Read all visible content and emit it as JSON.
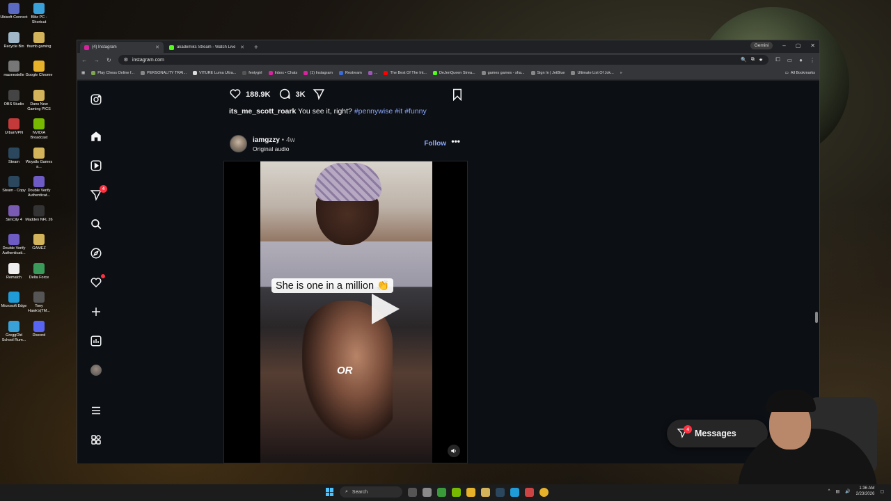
{
  "desktop": {
    "icons": [
      {
        "label": "Ubisoft Connect",
        "color": "#5b6bc4"
      },
      {
        "label": "Blitz PC - Shortcut",
        "color": "#3aa0d8"
      },
      {
        "label": "Recycle Bin",
        "color": "#9fb7c9"
      },
      {
        "label": "thumb gaming",
        "color": "#d4b45a"
      },
      {
        "label": "maxnestelle",
        "color": "#777777"
      },
      {
        "label": "Google Chrome",
        "color": "#e8b12a"
      },
      {
        "label": "OBS Studio",
        "color": "#444444"
      },
      {
        "label": "Dans New Gaming PICS",
        "color": "#d4b45a"
      },
      {
        "label": "UrbanVPN",
        "color": "#c43a3a"
      },
      {
        "label": "NVIDIA Broadcast",
        "color": "#76b900"
      },
      {
        "label": "Steam",
        "color": "#2a475e"
      },
      {
        "label": "Woyalls Games a...",
        "color": "#d4b45a"
      },
      {
        "label": "Steam - Copy",
        "color": "#2a475e"
      },
      {
        "label": "Double Verify Authenticat...",
        "color": "#6e5bc4"
      },
      {
        "label": "SimCity 4",
        "color": "#7a5bb4"
      },
      {
        "label": "Madden NFL 26",
        "color": "#333333"
      },
      {
        "label": "Double Verify Authenticati...",
        "color": "#6e5bc4"
      },
      {
        "label": "GAMEZ",
        "color": "#d4b45a"
      },
      {
        "label": "Rematch",
        "color": "#eeeeee"
      },
      {
        "label": "Delta Force",
        "color": "#3a9a5a"
      },
      {
        "label": "Microsoft Edge",
        "color": "#1f9bd8"
      },
      {
        "label": "Tony Hawk's(TM...",
        "color": "#555555"
      },
      {
        "label": "GreggOld School Rum...",
        "color": "#3aa0d8"
      },
      {
        "label": "Discord",
        "color": "#5865f2"
      }
    ]
  },
  "browser": {
    "tabs": [
      {
        "label": "(4) Instagram",
        "active": true,
        "color": "#d6249f"
      },
      {
        "label": "akademiks Stream - Watch Live",
        "active": false,
        "color": "#53fc18"
      }
    ],
    "new_tab": "+",
    "gemini": "Gemini",
    "window_controls": {
      "minimize": "–",
      "maximize": "▢",
      "close": "✕"
    },
    "url": "instagram.com",
    "bookmarks": [
      {
        "label": "Play Chess Online f...",
        "color": "#7fa650"
      },
      {
        "label": "PERSONALITY TRAI...",
        "color": "#888888"
      },
      {
        "label": "VITURE Luma Ultra...",
        "color": "#dddddd"
      },
      {
        "label": "fentygirl",
        "color": "#555555"
      },
      {
        "label": "Inbox • Chats",
        "color": "#d6249f"
      },
      {
        "label": "(1) Instagram",
        "color": "#d6249f"
      },
      {
        "label": "Restream",
        "color": "#3a6bd8"
      },
      {
        "label": "...",
        "color": "#9b59b6"
      },
      {
        "label": "The Best Of The Int...",
        "color": "#ff0000"
      },
      {
        "label": "DeJenQueen Strea...",
        "color": "#53fc18"
      },
      {
        "label": "games games - sha...",
        "color": "#888888"
      },
      {
        "label": "Sign In | JetBlue",
        "color": "#888888"
      },
      {
        "label": "Ultimate List Of Jok...",
        "color": "#888888"
      }
    ],
    "all_bookmarks": "All Bookmarks"
  },
  "instagram": {
    "sidebar": {
      "notifications_badge": "4"
    },
    "prev_post": {
      "likes": "188.9K",
      "comments": "3K",
      "caption_user": "its_me_scott_roark",
      "caption_text": "You see it, right?",
      "caption_tags": "#pennywise #it #funny"
    },
    "post": {
      "username": "iamgzzy",
      "time": " • 4w",
      "audio": "Original audio",
      "follow": "Follow",
      "more": "•••",
      "video_caption": "She is one in a million 👏",
      "video_overlay": "OR"
    },
    "messages": {
      "label": "Messages",
      "badge": "4"
    }
  },
  "taskbar": {
    "search": "Search",
    "time": "1:36 AM",
    "date": "2/23/2026"
  }
}
